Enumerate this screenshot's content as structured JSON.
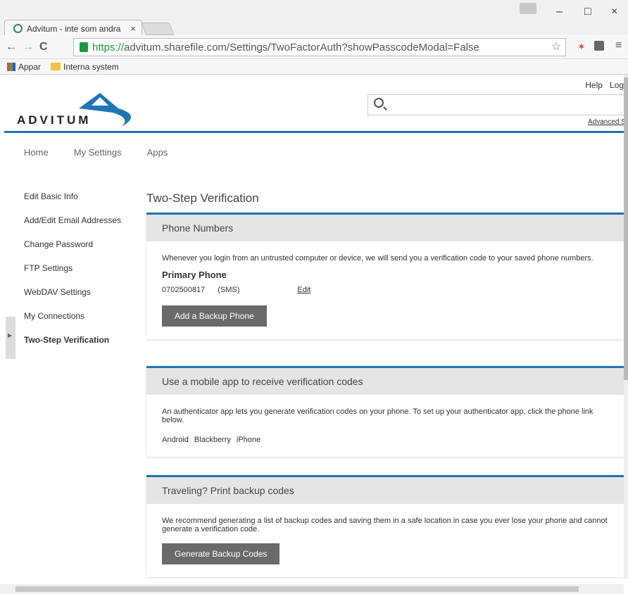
{
  "browser": {
    "tab_title": "Advitum - inte som andra",
    "tab_close": "×",
    "url_https": "https://",
    "url_rest": "advitum.sharefile.com/Settings/TwoFactorAuth?showPasscodeModal=False",
    "bookmarks": [
      {
        "label": "Appar"
      },
      {
        "label": "Interna system"
      }
    ],
    "back": "←",
    "forward": "→",
    "reload": "C",
    "minimize": "–",
    "maximize": "□",
    "close": "×",
    "star": "☆",
    "menu": "≡"
  },
  "header": {
    "help": "Help",
    "logout": "Log",
    "logo_text": "ADVITUM",
    "advanced_search": "Advanced S"
  },
  "topnav": [
    "Home",
    "My Settings",
    "Apps"
  ],
  "sidebar": [
    {
      "label": "Edit Basic Info"
    },
    {
      "label": "Add/Edit Email Addresses"
    },
    {
      "label": "Change Password"
    },
    {
      "label": "FTP Settings"
    },
    {
      "label": "WebDAV Settings"
    },
    {
      "label": "My Connections"
    },
    {
      "label": "Two-Step Verification"
    }
  ],
  "page": {
    "title": "Two-Step Verification"
  },
  "phone_card": {
    "header": "Phone Numbers",
    "desc": "Whenever you login from an untrusted computer or device, we will send you a verification code to your saved phone numbers.",
    "primary_label": "Primary Phone",
    "number": "0702500817",
    "method": "(SMS)",
    "edit": "Edit",
    "button": "Add a Backup Phone"
  },
  "app_card": {
    "header": "Use a mobile app to receive verification codes",
    "desc": "An authenticator app lets you generate verification codes on your phone. To set up your authenticator app, click the phone link below.",
    "links": [
      "Android",
      "Blackberry",
      "iPhone"
    ]
  },
  "backup_card": {
    "header": "Traveling? Print backup codes",
    "desc": "We recommend generating a list of backup codes and saving them in a safe location in case you ever lose your phone and cannot generate a verification code.",
    "button": "Generate Backup Codes"
  }
}
